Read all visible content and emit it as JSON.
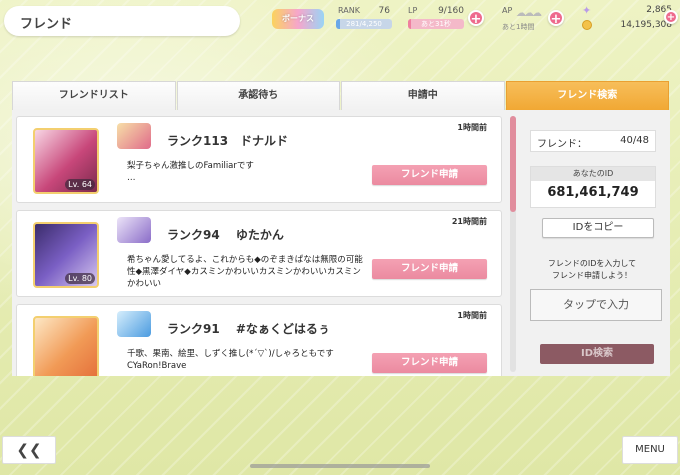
{
  "header": {
    "title": "フレンド",
    "logo_text": "ボーナス",
    "rank": {
      "label": "RANK",
      "value": "76",
      "progress": "281/4,250",
      "progress_fraction": 0.066
    },
    "lp": {
      "label": "LP",
      "value": "9/160",
      "sub": "あと31秒",
      "progress_fraction": 0.06
    },
    "ap": {
      "label": "AP",
      "sub": "あと1時間"
    },
    "gems": "2,865",
    "gold": "14,195,308"
  },
  "tabs": [
    {
      "label": "フレンドリスト",
      "active": false
    },
    {
      "label": "承認待ち",
      "active": false
    },
    {
      "label": "申請中",
      "active": false
    },
    {
      "label": "フレンド検索",
      "active": true
    }
  ],
  "users": [
    {
      "rank_name": "ランク113　ドナルド",
      "time": "1時間前",
      "message": "梨子ちゃん激推しのFamiliarです\n…",
      "level": "Lv. 64",
      "button": "フレンド申請"
    },
    {
      "rank_name": "ランク94　 ゆたかん",
      "time": "21時間前",
      "message": "希ちゃん愛してるよ、これからも◆のぞまきぱなは無限の可能性◆黒澤ダイヤ◆カスミンかわいいカスミンかわいいカスミンかわいい",
      "level": "Lv. 80",
      "button": "フレンド申請"
    },
    {
      "rank_name": "ランク91　 #なぁくどはるぅ",
      "time": "1時間前",
      "message": "千歌、果南、絵里、しずく推し(*´▽`)/しゃろともです　　　CYaRon!Brave",
      "level": "",
      "button": "フレンド申請"
    }
  ],
  "side": {
    "friend_label": "フレンド：",
    "friend_count": "40/48",
    "your_id_label": "あなたのID",
    "your_id": "681,461,749",
    "copy_button": "IDをコピー",
    "hint": "フレンドのIDを入力して\nフレンド申請しよう！",
    "input_placeholder": "タップで入力",
    "search_button": "ID検索"
  },
  "footer": {
    "back": "❮❮",
    "menu": "MENU"
  },
  "colors": {
    "active_tab": "#f2ac3a",
    "request_button": "#eb8aa0",
    "search_button": "#8c5a63",
    "background": "#e6edb4"
  }
}
